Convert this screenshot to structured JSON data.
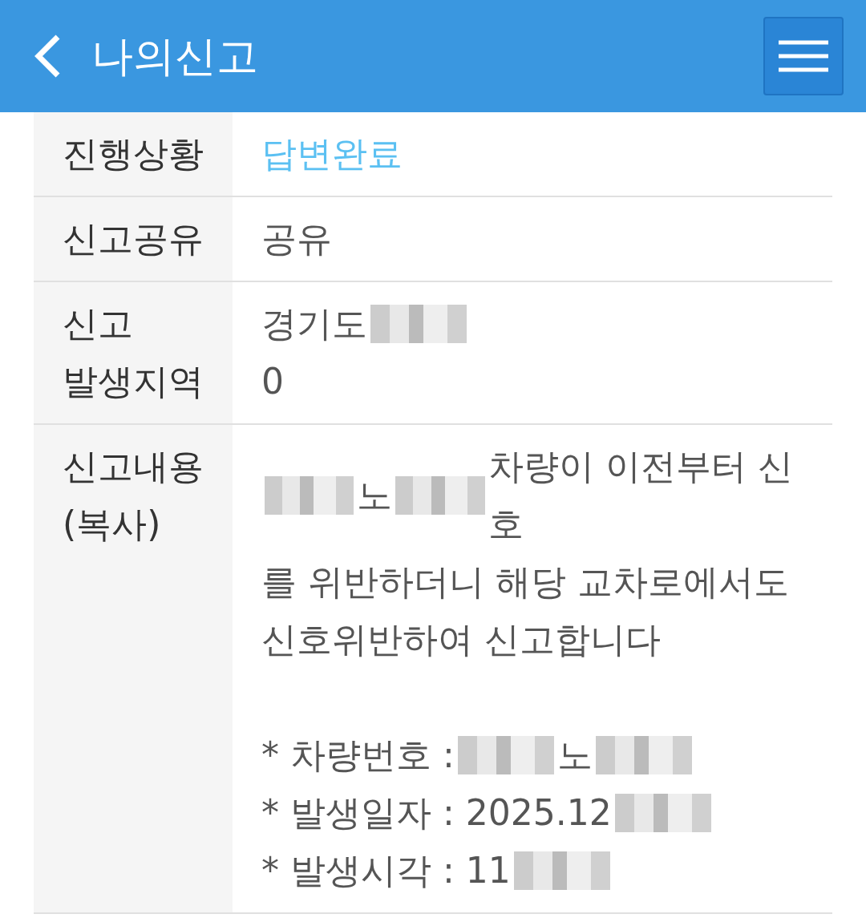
{
  "header": {
    "title": "나의신고"
  },
  "rows": [
    {
      "label": [
        "진행상황"
      ],
      "color": "#5bc0f2",
      "paragraphs": [
        [
          [
            {
              "kind": "text",
              "text": "답변완료"
            }
          ]
        ]
      ]
    },
    {
      "label": [
        "신고공유"
      ],
      "paragraphs": [
        [
          [
            {
              "kind": "text",
              "text": "공유"
            }
          ]
        ]
      ]
    },
    {
      "label": [
        "신고",
        "발생지역"
      ],
      "paragraphs": [
        [
          [
            {
              "kind": "text",
              "text": "경기도"
            },
            {
              "kind": "redacted"
            }
          ],
          [
            {
              "kind": "text",
              "text": "0"
            }
          ]
        ]
      ]
    },
    {
      "label": [
        "신고내용",
        "(복사)"
      ],
      "paragraphs": [
        [
          [
            {
              "kind": "redacted"
            },
            {
              "kind": "text",
              "text": "노"
            },
            {
              "kind": "redacted"
            },
            {
              "kind": "text",
              "text": "차량이 이전부터 신호"
            }
          ],
          [
            {
              "kind": "text",
              "text": "를 위반하더니 해당 교차로에서도"
            }
          ],
          [
            {
              "kind": "text",
              "text": "신호위반하여 신고합니다"
            }
          ]
        ],
        [
          [
            {
              "kind": "text",
              "text": "* 차량번호 :"
            },
            {
              "kind": "redacted"
            },
            {
              "kind": "text",
              "text": "노"
            },
            {
              "kind": "redacted"
            }
          ],
          [
            {
              "kind": "text",
              "text": "* 발생일자 : 2025.12"
            },
            {
              "kind": "redacted"
            }
          ],
          [
            {
              "kind": "text",
              "text": "* 발생시각 : 11"
            },
            {
              "kind": "redacted"
            }
          ]
        ]
      ]
    }
  ]
}
